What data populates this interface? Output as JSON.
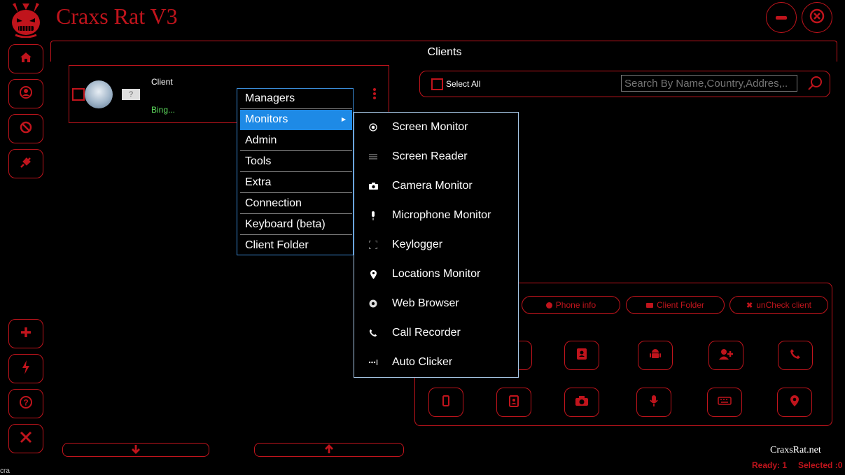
{
  "app": {
    "title": "Craxs Rat V3",
    "section_title": "Clients"
  },
  "window_controls": {
    "minimize": "minimize-icon",
    "close": "close-icon"
  },
  "sidebar": {
    "top_items": [
      {
        "icon": "home-icon"
      },
      {
        "icon": "user-icon"
      },
      {
        "icon": "block-icon"
      },
      {
        "icon": "plug-icon"
      }
    ],
    "bottom_items": [
      {
        "icon": "plus-icon"
      },
      {
        "icon": "lightning-icon"
      },
      {
        "icon": "help-icon"
      },
      {
        "icon": "tools-icon"
      }
    ]
  },
  "client_card": {
    "name": "Client",
    "status": "Bing...",
    "flag": "?"
  },
  "search": {
    "select_all": "Select All",
    "placeholder": "Search By Name,Country,Addres,.."
  },
  "context_menu": {
    "items": [
      "Managers",
      "Monitors",
      "Admin",
      "Tools",
      "Extra",
      "Connection",
      "Keyboard (beta)",
      "Client Folder"
    ],
    "selected": "Monitors"
  },
  "monitors_submenu": {
    "items": [
      {
        "label": "Screen Monitor",
        "icon": "radio-icon"
      },
      {
        "label": "Screen Reader",
        "icon": "lines-icon"
      },
      {
        "label": "Camera Monitor",
        "icon": "camera-icon"
      },
      {
        "label": "Microphone Monitor",
        "icon": "microphone-icon"
      },
      {
        "label": "Keylogger",
        "icon": "frame-icon"
      },
      {
        "label": "Locations Monitor",
        "icon": "location-pin-icon"
      },
      {
        "label": "Web Browser",
        "icon": "chrome-icon"
      },
      {
        "label": "Call Recorder",
        "icon": "phone-icon"
      },
      {
        "label": "Auto Clicker",
        "icon": "dots-icon"
      }
    ]
  },
  "actions": {
    "phone_info": "Phone info",
    "client_folder": "Client Folder",
    "uncheck_client": "unCheck client"
  },
  "grid_buttons": [
    {
      "icon": "contacts-icon"
    },
    {
      "icon": "android-icon"
    },
    {
      "icon": "add-user-icon"
    },
    {
      "icon": "phone-icon"
    },
    {
      "icon": "mobile-icon"
    },
    {
      "icon": "id-card-icon"
    },
    {
      "icon": "camera-icon"
    },
    {
      "icon": "microphone-icon"
    },
    {
      "icon": "keyboard-icon"
    },
    {
      "icon": "location-pin-icon"
    }
  ],
  "footer": {
    "site": "CraxsRat.net",
    "ready": "Ready: 1",
    "selected": "Selected :0",
    "corner_text": "cra"
  },
  "colors": {
    "accent": "#c0141c",
    "menu_highlight": "#1e8ae6",
    "status_green": "#5cd85c"
  }
}
